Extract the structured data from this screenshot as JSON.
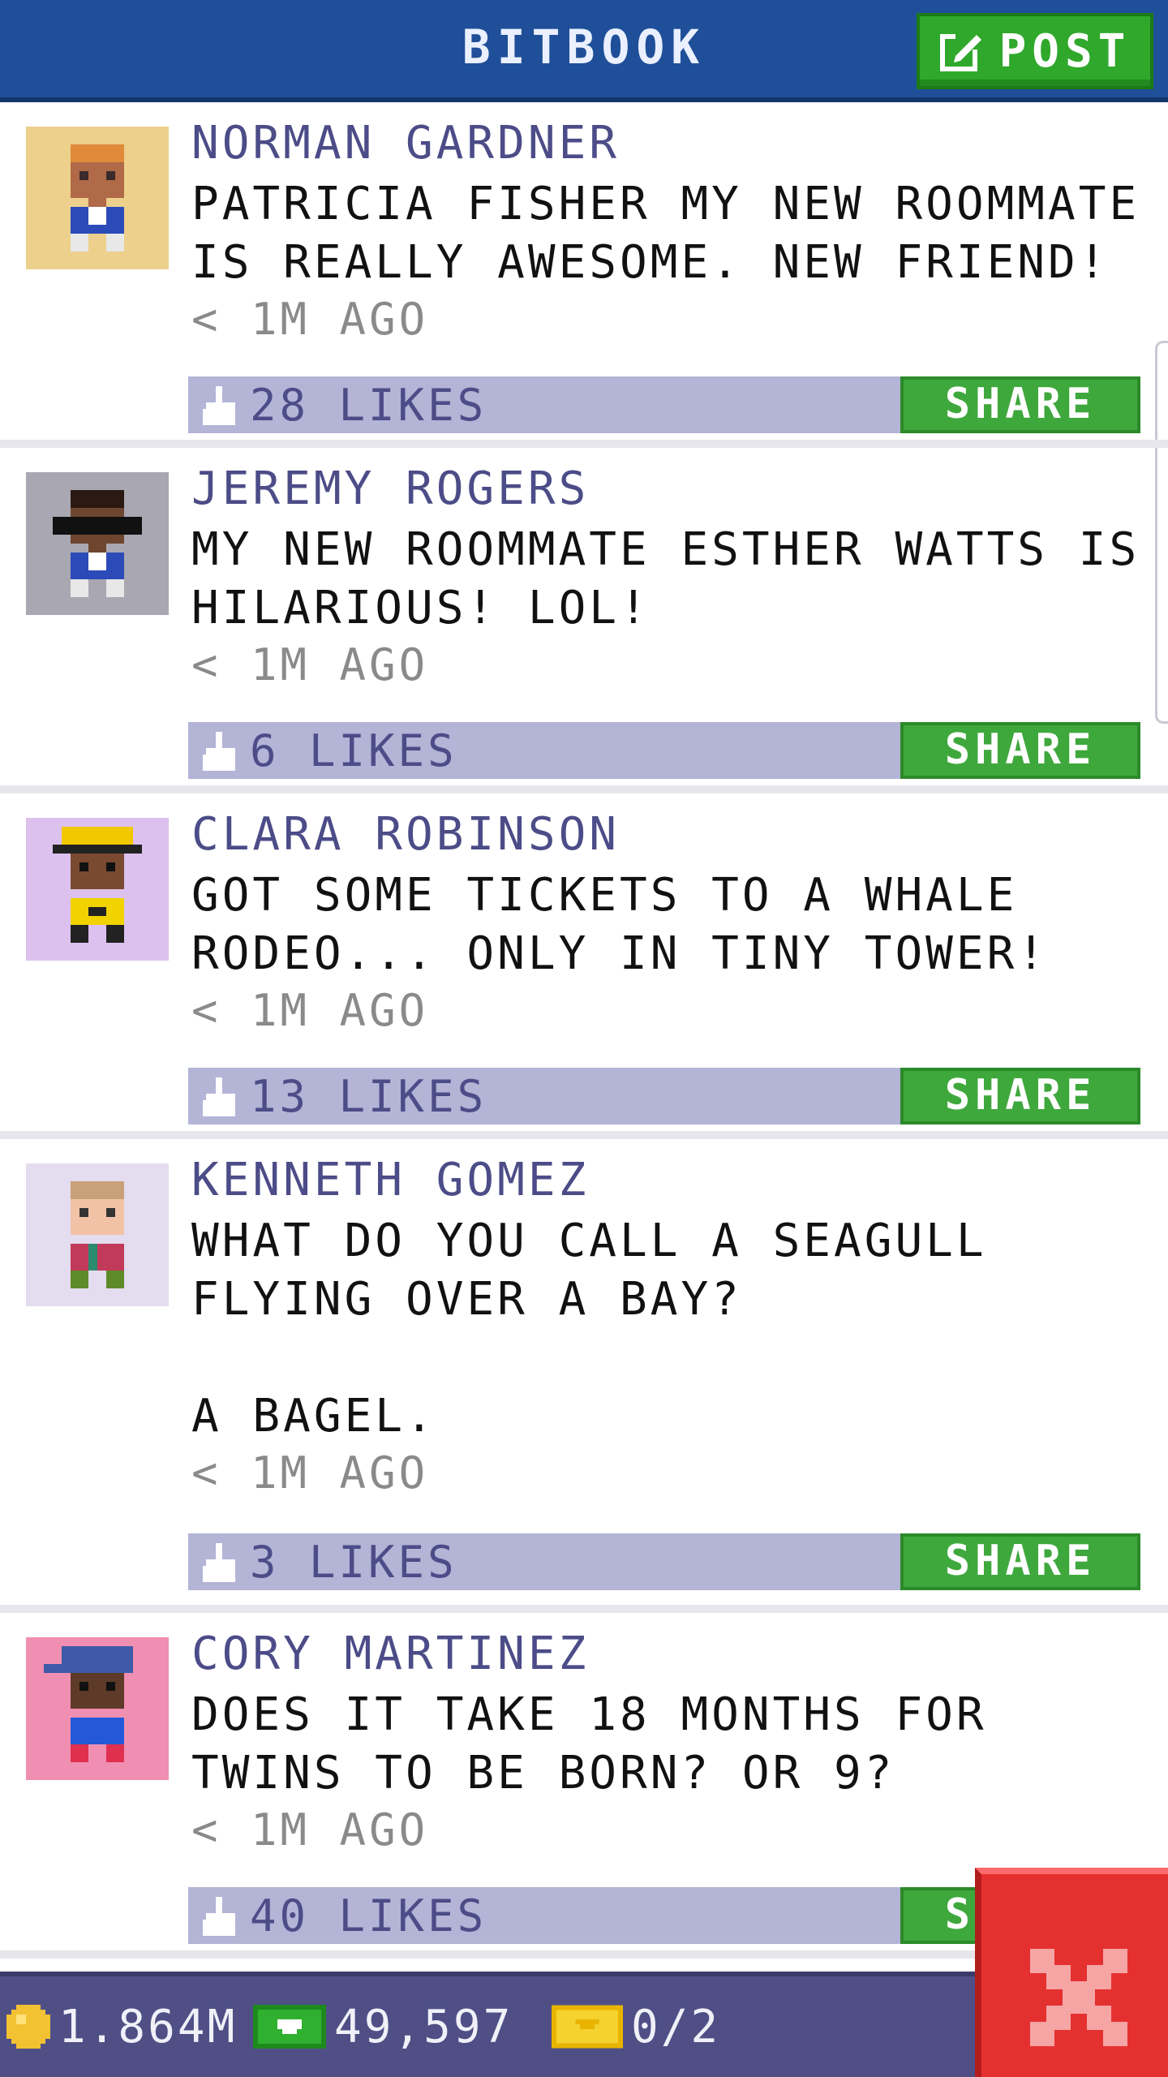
{
  "app": {
    "title": "BITBOOK",
    "post_button_label": "POST",
    "share_label": "SHARE"
  },
  "posts": [
    {
      "name": "NORMAN GARDNER",
      "message": "PATRICIA FISHER MY NEW ROOMMATE IS REALLY AWESOME. NEW FRIEND!",
      "time": "< 1M AGO",
      "likes": "28 LIKES",
      "avatar_bg": "#ecd08c"
    },
    {
      "name": "JEREMY ROGERS",
      "message": "MY NEW ROOMMATE ESTHER WATTS IS HILARIOUS! LOL!",
      "time": "< 1M AGO",
      "likes": "6 LIKES",
      "avatar_bg": "#a9a7b1"
    },
    {
      "name": "CLARA ROBINSON",
      "message": "GOT SOME TICKETS TO A WHALE RODEO... ONLY IN TINY TOWER!",
      "time": "< 1M AGO",
      "likes": "13 LIKES",
      "avatar_bg": "#dcc1ee"
    },
    {
      "name": "KENNETH GOMEZ",
      "message": "WHAT DO YOU CALL A SEAGULL FLYING OVER A BAY?\n\nA BAGEL.",
      "time": "< 1M AGO",
      "likes": "3 LIKES",
      "avatar_bg": "#e4dcef"
    },
    {
      "name": "CORY MARTINEZ",
      "message": "DOES IT TAKE 18 MONTHS FOR TWINS TO BE BORN? OR 9?",
      "time": "< 1M AGO",
      "likes": "40 LIKES",
      "avatar_bg": "#f08fb2"
    }
  ],
  "status_bar": {
    "coins": "1.864M",
    "bux": "49,597",
    "tickets": "0/2"
  },
  "icons": {
    "post": "edit-icon",
    "like": "thumbs-up-icon",
    "coin": "coin-icon",
    "bux": "bux-icon",
    "ticket": "ticket-icon",
    "close": "close-icon"
  },
  "colors": {
    "header": "#1f4f99",
    "accent_green": "#3fa83d",
    "name_text": "#4c4c88",
    "likes_bar": "#b3b4d6",
    "close_red": "#e53030"
  }
}
